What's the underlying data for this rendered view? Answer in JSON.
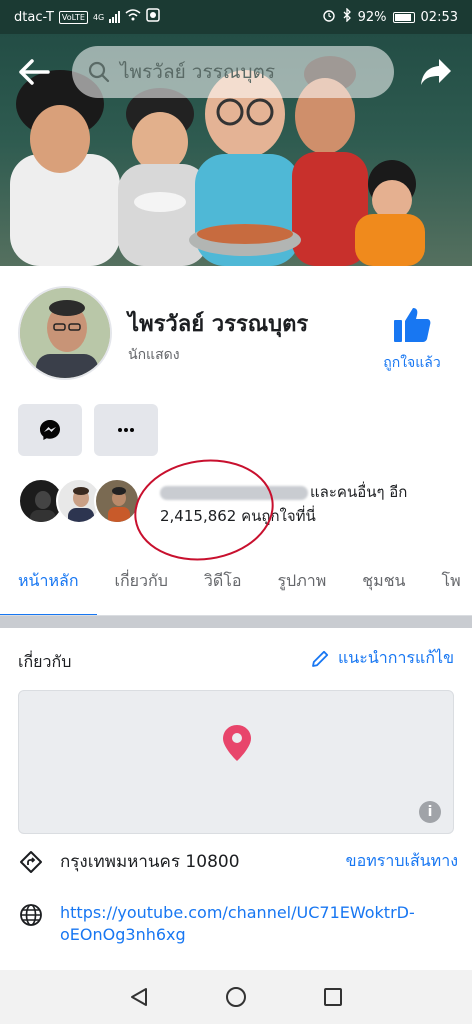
{
  "status_bar": {
    "carrier": "dtac-T",
    "volte": "VoLTE",
    "network": "4G",
    "battery": "92%",
    "time": "02:53"
  },
  "header": {
    "search_text": "ไพรวัลย์ วรรณบุตร"
  },
  "profile": {
    "name": "ไพรวัลย์ วรรณบุตร",
    "category": "นักแสดง",
    "like_label": "ถูกใจแล้ว",
    "likes_suffix": "และคนอื่นๆ อีก",
    "likes_count_text": "2,415,862 คนถูกใจที่นี่"
  },
  "tabs": [
    {
      "label": "หน้าหลัก"
    },
    {
      "label": "เกี่ยวกับ"
    },
    {
      "label": "วิดีโอ"
    },
    {
      "label": "รูปภาพ"
    },
    {
      "label": "ชุมชน"
    },
    {
      "label": "โพ"
    }
  ],
  "about": {
    "heading": "เกี่ยวกับ",
    "suggest_edit": "แนะนำการแก้ไข",
    "address": "กรุงเทพมหานคร 10800",
    "directions": "ขอทราบเส้นทาง",
    "link": "https://youtube.com/channel/UC71EWoktrD-oEOnOg3nh6xg"
  },
  "colors": {
    "accent": "#1877f2",
    "map_pin": "#e8456b",
    "annotation": "#c8102e"
  }
}
